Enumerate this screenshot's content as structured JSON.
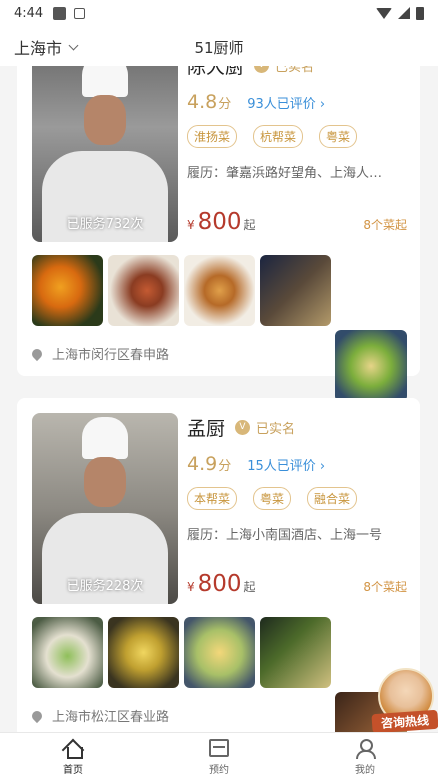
{
  "status_bar": {
    "time": "4:44"
  },
  "header": {
    "city": "上海市",
    "title": "51厨师"
  },
  "chefs": [
    {
      "name": "陈大厨",
      "verified": "已实名",
      "score": "4.8",
      "score_unit": "分",
      "reviews": "93人已评价 ›",
      "tags": [
        "淮扬菜",
        "杭帮菜",
        "粤菜"
      ],
      "resume": "履历：肇嘉浜路好望角、上海人…",
      "served": "已服务732次",
      "currency": "¥",
      "price": "800",
      "price_suffix": "起",
      "dish_count": "8个菜起",
      "address": "上海市闵行区春申路"
    },
    {
      "name": "孟厨",
      "verified": "已实名",
      "score": "4.9",
      "score_unit": "分",
      "reviews": "15人已评价 ›",
      "tags": [
        "本帮菜",
        "粤菜",
        "融合菜"
      ],
      "resume": "履历：上海小南国酒店、上海一号",
      "served": "已服务228次",
      "currency": "¥",
      "price": "800",
      "price_suffix": "起",
      "dish_count": "8个菜起",
      "address": "上海市松江区春业路"
    }
  ],
  "consult": {
    "label": "咨询热线"
  },
  "bottom_nav": [
    {
      "label": "首页",
      "icon": "home-icon"
    },
    {
      "label": "预约",
      "icon": "calendar-icon"
    },
    {
      "label": "我的",
      "icon": "user-icon"
    }
  ],
  "colors": {
    "gold": "#c8a15d",
    "price": "#b53a2c",
    "link": "#3a8fd9"
  }
}
